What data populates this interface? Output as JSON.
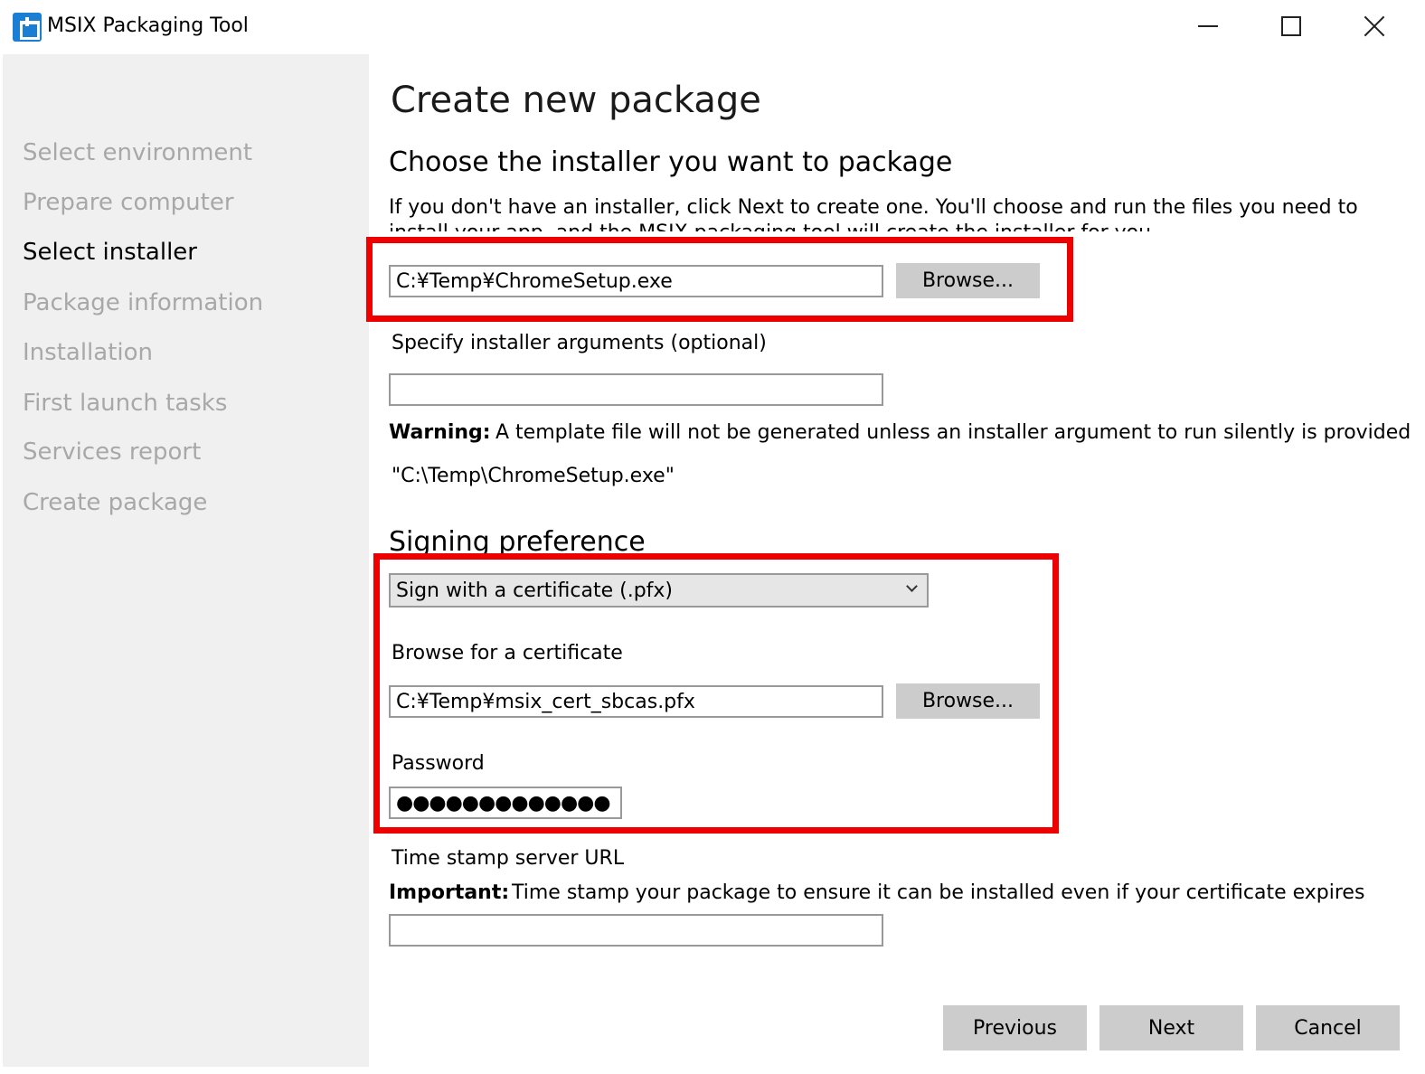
{
  "window": {
    "title": "MSIX Packaging Tool"
  },
  "sidebar": {
    "items": [
      {
        "label": "Select environment",
        "state": "inactive"
      },
      {
        "label": "Prepare computer",
        "state": "inactive"
      },
      {
        "label": "Select installer",
        "state": "active"
      },
      {
        "label": "Package information",
        "state": "inactive"
      },
      {
        "label": "Installation",
        "state": "inactive"
      },
      {
        "label": "First launch tasks",
        "state": "inactive"
      },
      {
        "label": "Services report",
        "state": "inactive"
      },
      {
        "label": "Create package",
        "state": "inactive"
      }
    ]
  },
  "main": {
    "page_title": "Create new package",
    "installer": {
      "heading": "Choose the installer you want to package",
      "description": "If you don't have an installer, click Next to create one. You'll choose and run the files you need to install your app, and the MSIX packaging tool will create the installer for you.",
      "path_value": "C:¥Temp¥ChromeSetup.exe",
      "browse_label": "Browse...",
      "args_label": "Specify installer arguments (optional)",
      "args_value": "",
      "warning_label": "Warning:",
      "warning_text": "A template file will not be generated unless an installer argument to run silently is provided",
      "command_preview": "\"C:\\Temp\\ChromeSetup.exe\""
    },
    "signing": {
      "heading": "Signing preference",
      "selected_option": "Sign with a certificate (.pfx)",
      "cert_label": "Browse for a certificate",
      "cert_value": "C:¥Temp¥msix_cert_sbcas.pfx",
      "browse_label": "Browse...",
      "password_label": "Password",
      "password_mask": "●●●●●●●●●●●●●",
      "timestamp_label": "Time stamp server URL",
      "important_label": "Important:",
      "important_text": "Time stamp your package to ensure it can be installed even if your certificate expires",
      "timestamp_value": ""
    },
    "footer": {
      "previous_label": "Previous",
      "next_label": "Next",
      "cancel_label": "Cancel"
    }
  },
  "colors": {
    "highlight": "#ee0000",
    "sidebar_bg": "#f0f0f0",
    "button_bg": "#cccccc",
    "inactive_nav": "#a8a8a8"
  }
}
